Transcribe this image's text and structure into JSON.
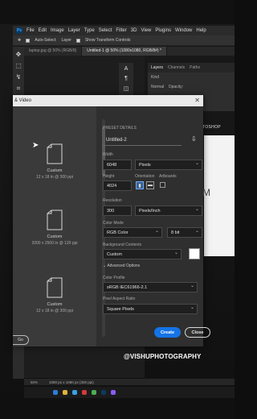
{
  "menubar": {
    "logo": "Ps",
    "items": [
      "File",
      "Edit",
      "Image",
      "Layer",
      "Type",
      "Select",
      "Filter",
      "3D",
      "View",
      "Plugins",
      "Window",
      "Help"
    ]
  },
  "optionsbar": {
    "auto_select": "Auto-Select:",
    "layer": "Layer",
    "show_transform": "Show Transform Controls"
  },
  "tabs": [
    {
      "label": "laptop.jpg @ 50% (RGB/8)"
    },
    {
      "label": "Untitled-1 @ 50% (1080x1080, RGB/8#) *"
    }
  ],
  "layers_panel": {
    "tabs": [
      "Layers",
      "Channels",
      "Paths"
    ],
    "kind": "Kind",
    "mode": "Normal",
    "opacity": "Opacity:"
  },
  "side_text": {
    "toshop": "TOSHOP",
    "letter": "M"
  },
  "dialog": {
    "title": "& Video",
    "close_glyph": "✕",
    "presets": [
      {
        "name": "Custom",
        "dims": "12 x 18 in @ 300 ppi"
      },
      {
        "name": "Custom",
        "dims": "2000 x 2500 in @ 120 ppi"
      },
      {
        "name": "Custom",
        "dims": "12 x 18 in @ 300 ppi"
      }
    ],
    "left_close": "Go",
    "details": {
      "section": "PRESET DETAILS",
      "name": "Untitled-2",
      "width_label": "Width",
      "width_value": "6048",
      "width_unit": "Pixels",
      "height_label": "Height",
      "height_value": "4024",
      "orientation_label": "Orientation",
      "artboards_label": "Artboards",
      "resolution_label": "Resolution",
      "resolution_value": "300",
      "resolution_unit": "Pixels/Inch",
      "color_mode_label": "Color Mode",
      "color_mode_value": "RGB Color",
      "bit_depth": "8 bit",
      "bg_label": "Background Contents",
      "bg_value": "Custom",
      "bg_color": "#ffffff",
      "advanced": "Advanced Options",
      "profile_label": "Color Profile",
      "profile_value": "sRGB IEC61966-2.1",
      "aspect_label": "Pixel Aspect Ratio",
      "aspect_value": "Square Pixels"
    },
    "create": "Create",
    "close": "Close"
  },
  "watermark": "@VISHUPHOTOGRAPHY",
  "status": {
    "zoom": "50%",
    "size": "1080 px x 1080 px (300 ppi)"
  },
  "colors": {
    "accent": "#1473e6"
  }
}
